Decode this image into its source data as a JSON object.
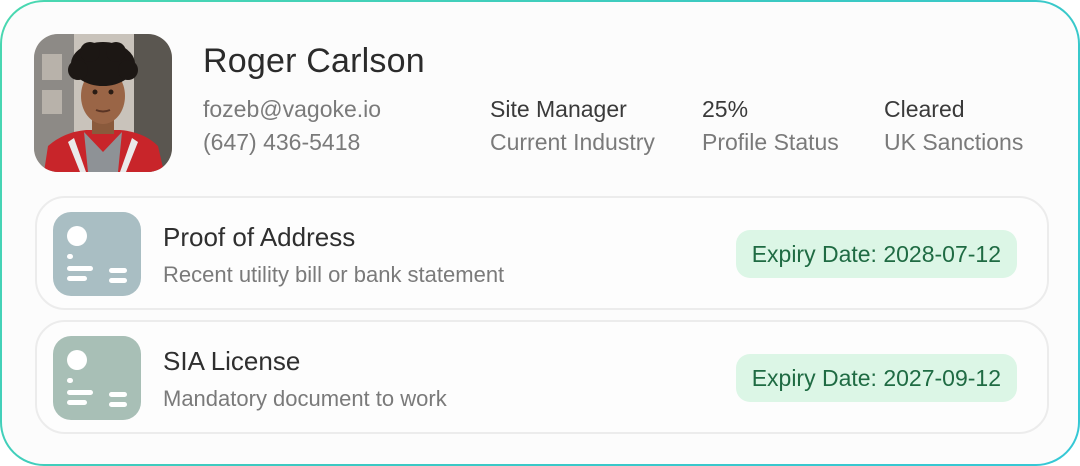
{
  "profile": {
    "name": "Roger Carlson",
    "email": "fozeb@vagoke.io",
    "phone": "(647) 436-5418",
    "industry": {
      "value": "Site Manager",
      "label": "Current Industry"
    },
    "profile_status": {
      "value": "25%",
      "label": "Profile Status"
    },
    "sanctions": {
      "value": "Cleared",
      "label": "UK Sanctions"
    }
  },
  "documents": [
    {
      "title": "Proof of Address",
      "subtitle": "Recent utility bill or bank statement",
      "expiry": "Expiry Date: 2028-07-12",
      "icon": "document-icon"
    },
    {
      "title": "SIA License",
      "subtitle": "Mandatory document to work",
      "expiry": "Expiry Date: 2027-09-12",
      "icon": "document-icon"
    }
  ],
  "colors": {
    "border_gradient_start": "#4ad8b0",
    "border_gradient_end": "#35c8d6",
    "expiry_bg": "#dcf6e6",
    "expiry_text": "#1f6b43"
  }
}
